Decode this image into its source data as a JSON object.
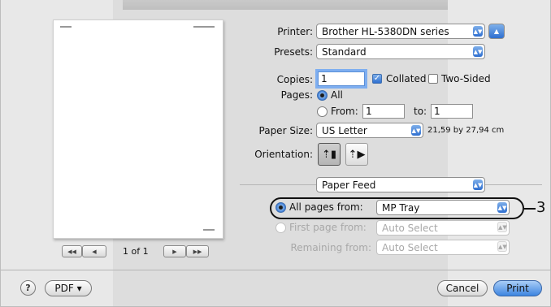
{
  "printer": {
    "label": "Printer:",
    "value": "Brother HL-5380DN series"
  },
  "presets": {
    "label": "Presets:",
    "value": "Standard"
  },
  "copies": {
    "label": "Copies:",
    "value": "1",
    "collated_label": "Collated",
    "collated_checked": true,
    "two_sided_label": "Two-Sided",
    "two_sided_checked": false
  },
  "pages": {
    "label": "Pages:",
    "all_label": "All",
    "from_label": "From:",
    "from_value": "1",
    "to_label": "to:",
    "to_value": "1",
    "selected": "All"
  },
  "paper_size": {
    "label": "Paper Size:",
    "value": "US Letter",
    "dimensions": "21,59 by 27,94 cm"
  },
  "orientation": {
    "label": "Orientation:",
    "selected": "portrait"
  },
  "section": {
    "value": "Paper Feed"
  },
  "feed": {
    "all_pages_label": "All pages from:",
    "all_pages_value": "MP Tray",
    "first_page_label": "First page from:",
    "first_page_value": "Auto Select",
    "remaining_label": "Remaining from:",
    "remaining_value": "Auto Select",
    "selected": "all_pages"
  },
  "preview": {
    "page_count": "1 of 1",
    "first": "◀◀",
    "prev": "◀",
    "next": "▶",
    "last": "▶▶"
  },
  "callout": {
    "number": "3"
  },
  "footer": {
    "help": "?",
    "pdf": "PDF ▾",
    "cancel": "Cancel",
    "print": "Print"
  },
  "colors": {
    "accent": "#2e6fd0",
    "focus_ring": "#7eaef0",
    "disabled_text": "#a8a8a8"
  }
}
